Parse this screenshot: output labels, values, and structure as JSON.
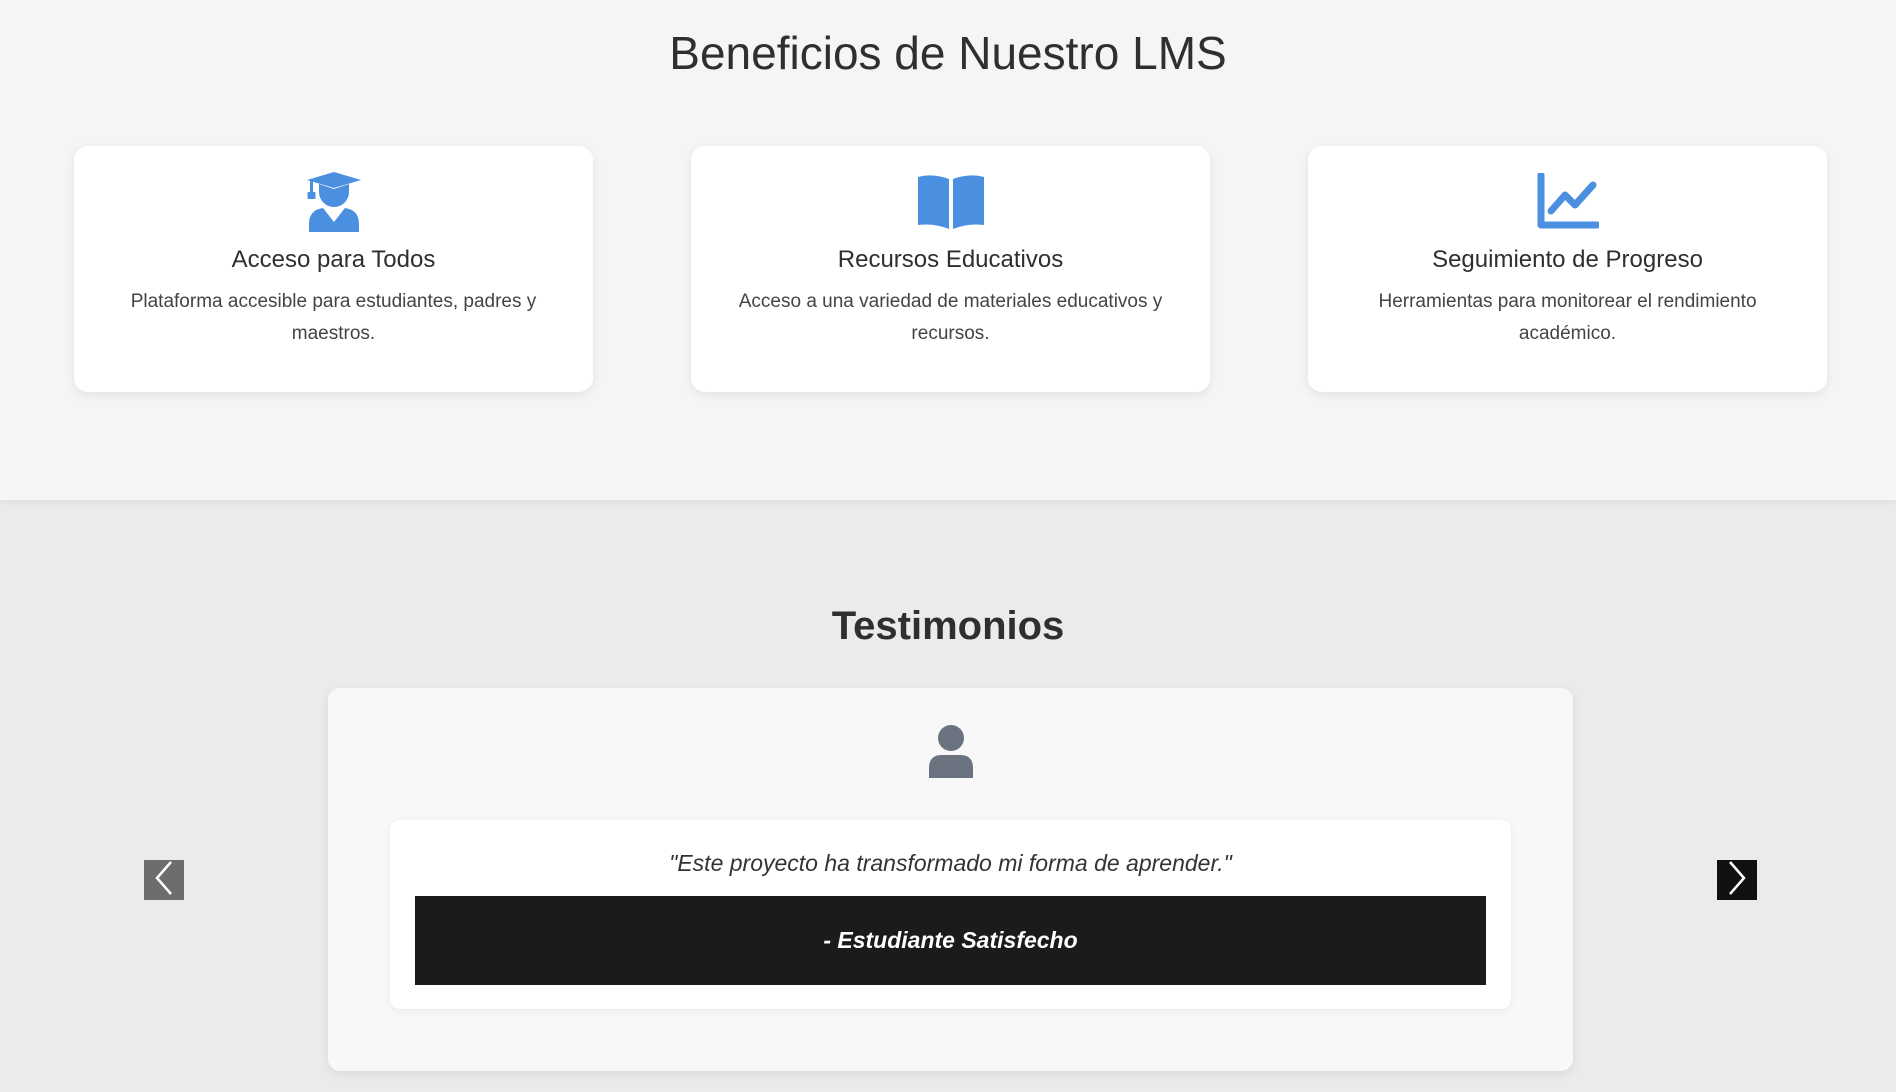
{
  "benefits": {
    "title": "Beneficios de Nuestro LMS",
    "accent_color": "#4a8fe0",
    "cards": [
      {
        "icon": "graduate-icon",
        "title": "Acceso para Todos",
        "description": "Plataforma accesible para estudiantes, padres y maestros."
      },
      {
        "icon": "open-book-icon",
        "title": "Recursos Educativos",
        "description": "Acceso a una variedad de materiales educativos y recursos."
      },
      {
        "icon": "line-chart-icon",
        "title": "Seguimiento de Progreso",
        "description": "Herramientas para monitorear el rendimiento académico."
      }
    ]
  },
  "testimonials": {
    "title": "Testimonios",
    "avatar_icon": "user-icon",
    "quote": "\"Este proyecto ha transformado mi forma de aprender.\"",
    "author": "- Estudiante Satisfecho",
    "prev_icon": "chevron-left-icon",
    "next_icon": "chevron-right-icon"
  }
}
